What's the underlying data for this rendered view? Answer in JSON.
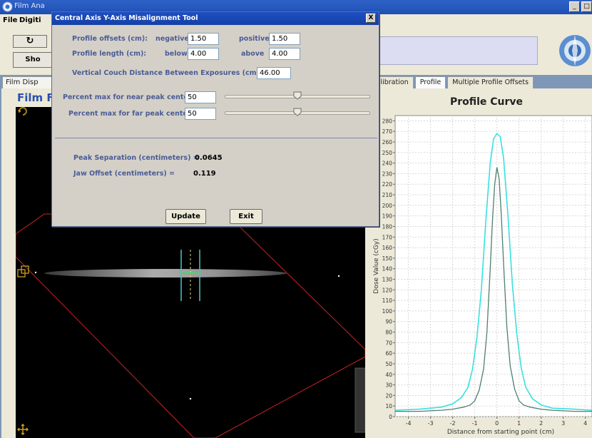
{
  "main_window": {
    "title": "Film Ana",
    "menu": [
      "File",
      "Digiti"
    ],
    "toolbar": {
      "refresh_glyph": "↻",
      "show_label": "Sho"
    },
    "window_buttons": [
      "_",
      "□"
    ]
  },
  "left_panel": {
    "tab_label": "Film Disp",
    "header": "Film Fi"
  },
  "right_panel": {
    "tabs": [
      {
        "label": "Calibration",
        "active": false
      },
      {
        "label": "Profile",
        "active": true
      },
      {
        "label": "Multiple Profile Offsets",
        "active": false
      }
    ]
  },
  "dialog": {
    "title": "Central Axis Y-Axis Misalignment Tool",
    "close_label": "X",
    "profile_offsets_label": "Profile offsets (cm):",
    "negative_label": "negative",
    "negative_value": "1.50",
    "positive_label": "positive",
    "positive_value": "1.50",
    "profile_length_label": "Profile length (cm):",
    "below_label": "below",
    "below_value": "4.00",
    "above_label": "above",
    "above_value": "4.00",
    "couch_distance_label": "Vertical Couch Distance Between Exposures (cm):",
    "couch_distance_value": "46.00",
    "near_peak_label": "Percent max for near peak center",
    "near_peak_value": "50",
    "near_slider_fraction": 0.5,
    "far_peak_label": "Percent max for far peak center",
    "far_peak_value": "50",
    "far_slider_fraction": 0.5,
    "peak_separation_label": "Peak Separation (centimeters)  =",
    "peak_separation_value": "0.0645",
    "jaw_offset_label": "Jaw Offset (centimeters)         =",
    "jaw_offset_value": "0.119",
    "update_label": "Update",
    "exit_label": "Exit"
  },
  "chart_data": {
    "type": "line",
    "title": "Profile Curve",
    "xlabel": "Distance from starting point (cm)",
    "ylabel": "Dose Value (cGy)",
    "xlim": [
      -4.6,
      4.3
    ],
    "ylim": [
      0,
      285
    ],
    "xticks": [
      -4,
      -3,
      -2,
      -1,
      0,
      1,
      2,
      3,
      4
    ],
    "yticks": [
      0,
      10,
      20,
      30,
      40,
      50,
      60,
      70,
      80,
      90,
      100,
      110,
      120,
      130,
      140,
      150,
      160,
      170,
      180,
      190,
      200,
      210,
      220,
      230,
      240,
      250,
      260,
      270,
      280
    ],
    "grid": true,
    "series": [
      {
        "color": "#38e0e0",
        "x": [
          -4.6,
          -3.5,
          -2.5,
          -2.0,
          -1.6,
          -1.3,
          -1.1,
          -0.9,
          -0.7,
          -0.5,
          -0.3,
          -0.15,
          0.0,
          0.15,
          0.3,
          0.5,
          0.7,
          0.9,
          1.1,
          1.3,
          1.6,
          2.0,
          2.5,
          3.5,
          4.3
        ],
        "y": [
          6,
          7,
          9,
          12,
          18,
          28,
          45,
          75,
          120,
          185,
          240,
          263,
          268,
          265,
          245,
          190,
          125,
          78,
          46,
          28,
          17,
          11,
          8,
          7,
          6
        ]
      },
      {
        "color": "#4f7f6f",
        "x": [
          -4.6,
          -3.5,
          -2.5,
          -2.0,
          -1.5,
          -1.2,
          -1.0,
          -0.8,
          -0.6,
          -0.45,
          -0.3,
          -0.2,
          -0.1,
          0.0,
          0.1,
          0.2,
          0.3,
          0.45,
          0.6,
          0.8,
          1.0,
          1.2,
          1.5,
          2.0,
          2.5,
          3.5,
          4.3
        ],
        "y": [
          5,
          5,
          6,
          7,
          9,
          11,
          15,
          25,
          45,
          80,
          140,
          185,
          220,
          236,
          225,
          190,
          145,
          85,
          48,
          26,
          15,
          11,
          9,
          7,
          6,
          5,
          5
        ]
      }
    ]
  }
}
